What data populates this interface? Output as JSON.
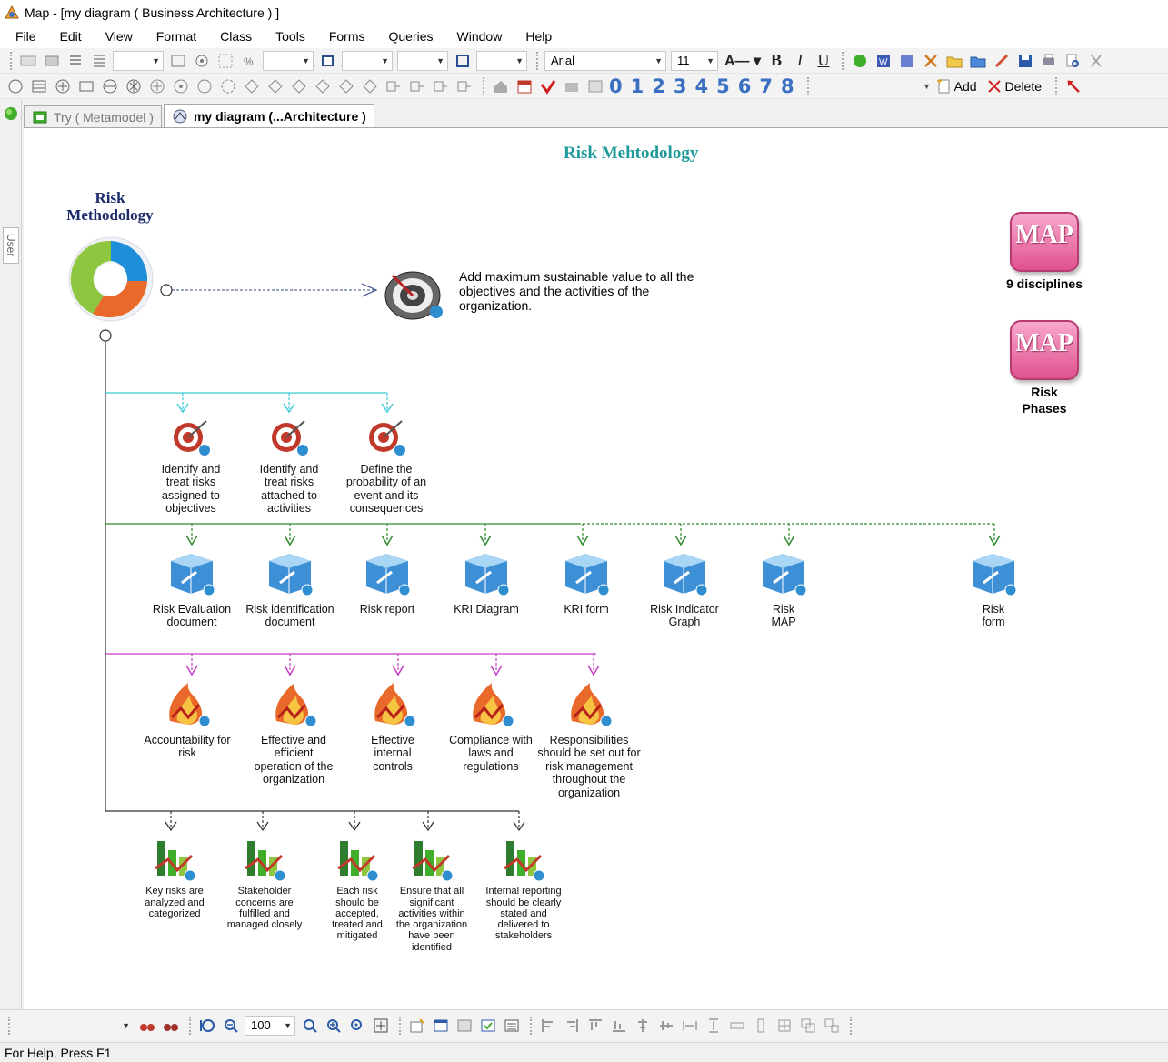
{
  "window": {
    "title": "Map - [my diagram ( Business Architecture ) ]"
  },
  "menu": [
    "File",
    "Edit",
    "View",
    "Format",
    "Class",
    "Tools",
    "Forms",
    "Queries",
    "Window",
    "Help"
  ],
  "toolbar": {
    "font_name": "Arial",
    "font_size": "11",
    "level_buttons": [
      "0",
      "1",
      "2",
      "3",
      "4",
      "5",
      "6",
      "7",
      "8"
    ],
    "add_label": "Add",
    "delete_label": "Delete"
  },
  "left_panel": {
    "user_tab": "User"
  },
  "tabs": [
    {
      "label": "Try ( Metamodel )",
      "active": false
    },
    {
      "label": "my diagram (...Architecture )",
      "active": true
    }
  ],
  "diagram": {
    "title": "Risk Mehtodology",
    "root_label": "Risk Methodology",
    "goal_text": "Add maximum sustainable value to all the objectives and the activities of the organization.",
    "maps": [
      {
        "label": "9 disciplines",
        "icon_text": "MAP"
      },
      {
        "label": "Risk Phases",
        "icon_text": "MAP"
      }
    ],
    "objectives": [
      "Identify and treat risks assigned to objectives",
      "Identify and treat risks attached to activities",
      "Define the probability of an event and its consequences"
    ],
    "documents": [
      "Risk Evaluation document",
      "Risk identification document",
      "Risk report",
      "KRI Diagram",
      "KRI form",
      "Risk Indicator Graph",
      "Risk MAP",
      "Risk form"
    ],
    "principles": [
      "Accountability for risk",
      "Effective and efficient operation of the organization",
      "Effective internal controls",
      "Compliance with laws and regulations",
      "Responsibilities should be set out for risk management throughout the organization"
    ],
    "practices": [
      "Key risks are analyzed and categorized",
      "Stakeholder concerns are fulfilled and managed closely",
      "Each risk should be accepted, treated and mitigated",
      "Ensure that all significant activities within the organization have been identified",
      "Internal reporting should be clearly stated and delivered to stakeholders"
    ],
    "colors": {
      "title": "#1f9a9a",
      "objective_link": "#3fc9d8",
      "document_link": "#2e8b2e",
      "principle_link": "#c63cc6",
      "practice_link": "#333333"
    }
  },
  "zoom": {
    "value": "100"
  },
  "status": {
    "text": "For Help, Press F1"
  }
}
